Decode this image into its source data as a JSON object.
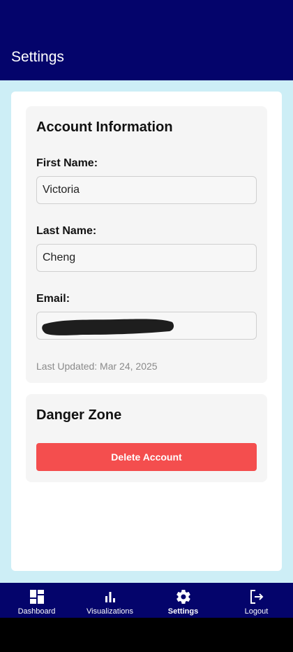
{
  "header": {
    "title": "Settings"
  },
  "account": {
    "heading": "Account Information",
    "first_name_label": "First Name:",
    "first_name_value": "Victoria",
    "last_name_label": "Last Name:",
    "last_name_value": "Cheng",
    "email_label": "Email:",
    "email_value": "",
    "last_updated": "Last Updated: Mar 24, 2025"
  },
  "danger": {
    "heading": "Danger Zone",
    "delete_label": "Delete Account"
  },
  "nav": {
    "items": [
      {
        "label": "Dashboard",
        "icon": "dashboard-icon"
      },
      {
        "label": "Visualizations",
        "icon": "bar-chart-icon"
      },
      {
        "label": "Settings",
        "icon": "gear-icon",
        "active": true
      },
      {
        "label": "Logout",
        "icon": "logout-icon"
      }
    ]
  },
  "colors": {
    "header_bg": "#04046b",
    "page_bg": "#cdeef6",
    "danger_button": "#f44e4e"
  }
}
